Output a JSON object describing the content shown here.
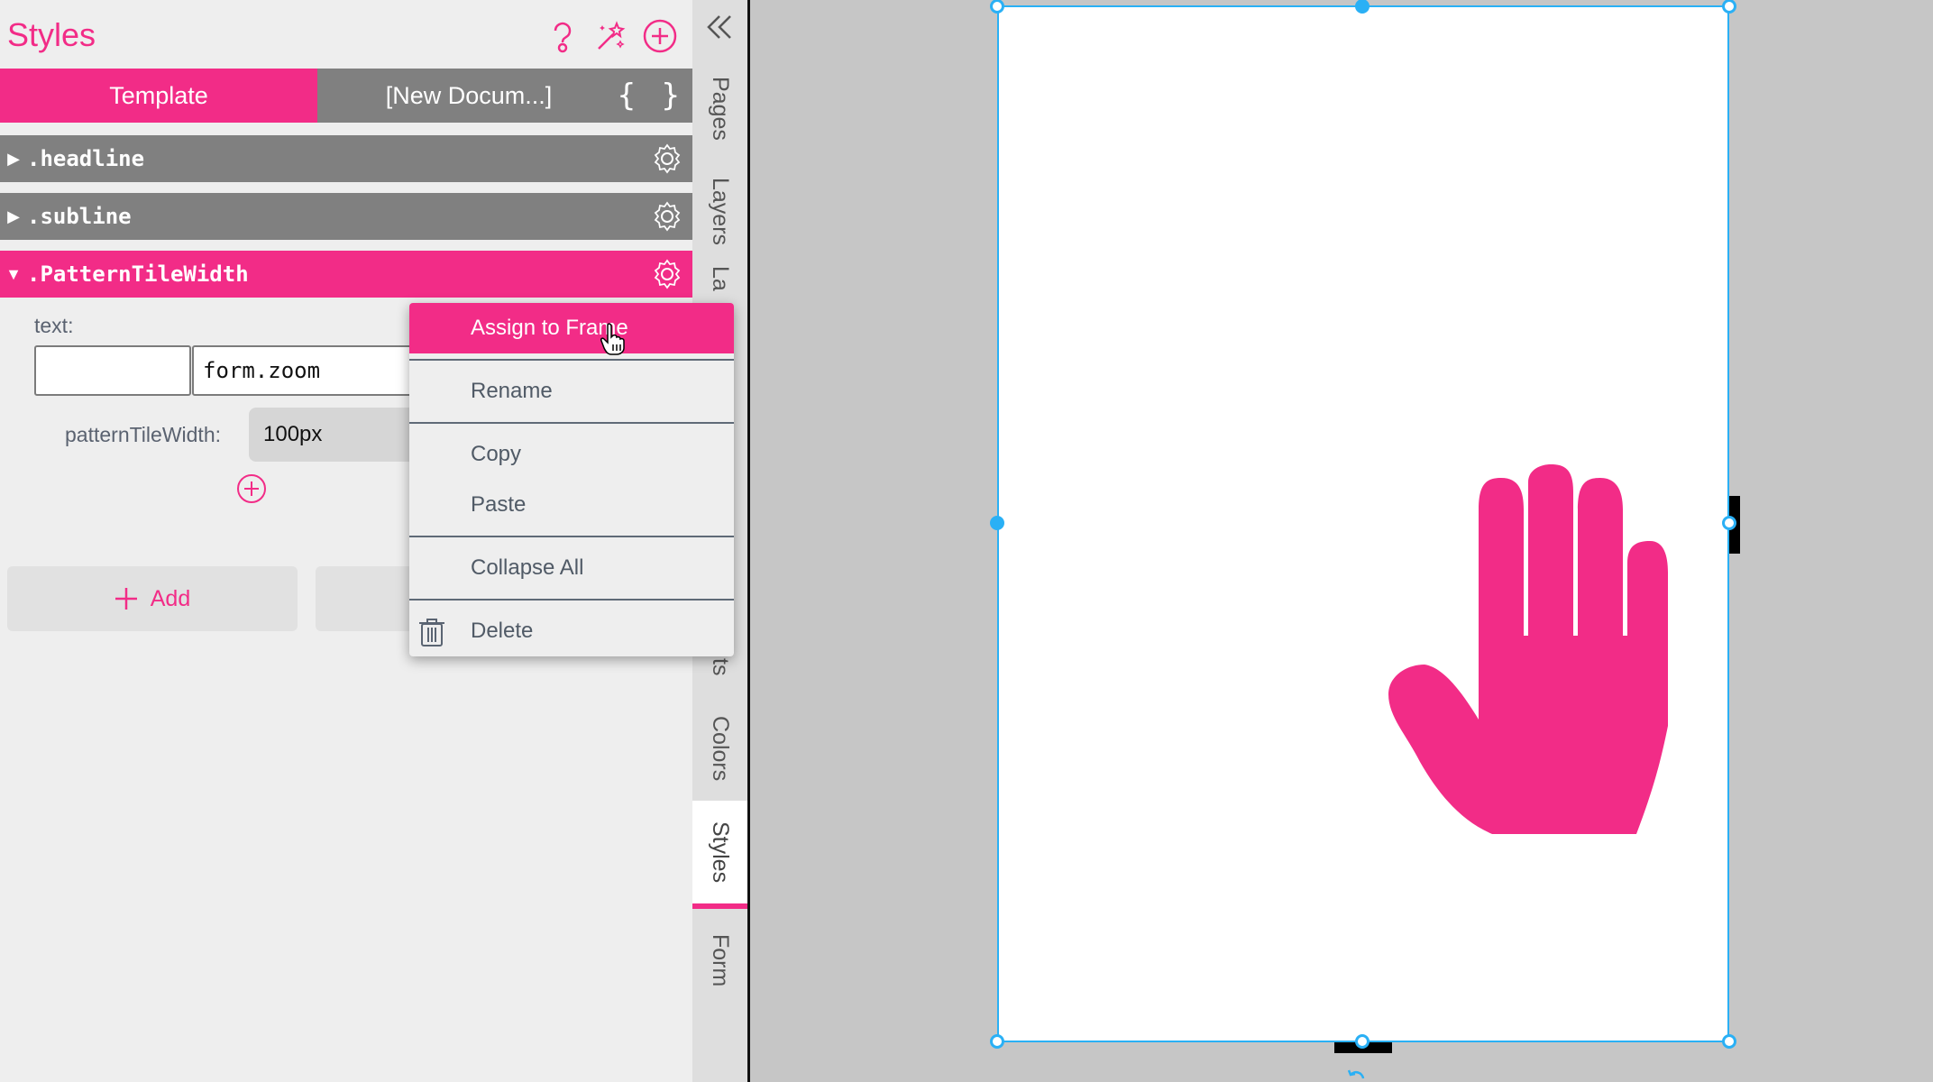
{
  "panel": {
    "title": "Styles",
    "header_icons": [
      "help-icon",
      "magic-wand-icon",
      "add-circle-icon"
    ],
    "tabs": [
      {
        "label": "Template",
        "active": true
      },
      {
        "label": "[New Docum...]",
        "active": false
      }
    ],
    "braces_label": "{ }",
    "styles": [
      {
        "name": ".headline",
        "expanded": false
      },
      {
        "name": ".subline",
        "expanded": false
      },
      {
        "name": ".PatternTileWidth",
        "expanded": true
      }
    ],
    "expanded_style": {
      "text_label": "text:",
      "text_prefix_value": "",
      "text_value": "form.zoom",
      "property_label": "patternTileWidth:",
      "property_value": "100px"
    },
    "add_button_label": "Add"
  },
  "side_tabs": {
    "collapse_icon": "double-chevron-left-icon",
    "items": [
      {
        "label": "Pages",
        "active": false
      },
      {
        "label": "Layers",
        "active": false
      },
      {
        "label": "La",
        "active": false
      },
      {
        "label": "ts",
        "active": false
      },
      {
        "label": "Colors",
        "active": false
      },
      {
        "label": "Styles",
        "active": true
      },
      {
        "label": "Form",
        "active": false
      }
    ]
  },
  "context_menu": {
    "items": [
      {
        "label": "Assign to Frame",
        "highlighted": true
      },
      {
        "label": "Rename"
      },
      {
        "label": "Copy"
      },
      {
        "label": "Paste"
      },
      {
        "label": "Collapse All"
      },
      {
        "label": "Delete",
        "icon": "trash-icon"
      }
    ]
  },
  "colors": {
    "accent": "#f22c87",
    "row_gray": "#808080",
    "selection": "#2ab0f5",
    "canvas_bg": "#c6c6c6"
  }
}
